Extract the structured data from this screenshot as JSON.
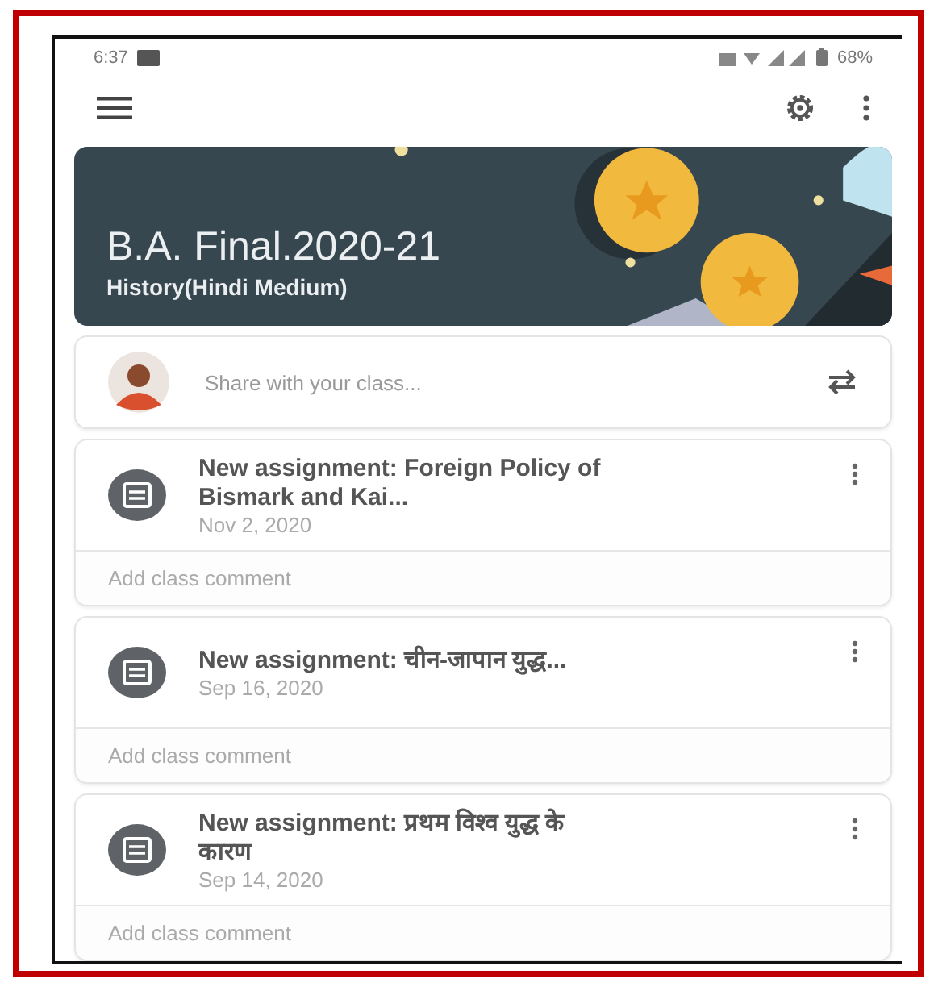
{
  "status_bar": {
    "time": "6:37",
    "battery": "68%"
  },
  "class": {
    "title": "B.A. Final.2020-21",
    "subtitle": "History(Hindi Medium)"
  },
  "share": {
    "placeholder": "Share with your class..."
  },
  "posts": [
    {
      "title": "New assignment: Foreign Policy of Bismark and Kai...",
      "date": "Nov 2, 2020",
      "comment_placeholder": "Add class comment"
    },
    {
      "title": "New assignment: चीन-जापान युद्ध...",
      "date": "Sep 16, 2020",
      "comment_placeholder": "Add class comment"
    },
    {
      "title": "New assignment: प्रथम विश्व युद्ध के कारण",
      "date": "Sep 14, 2020",
      "comment_placeholder": "Add class comment"
    }
  ]
}
